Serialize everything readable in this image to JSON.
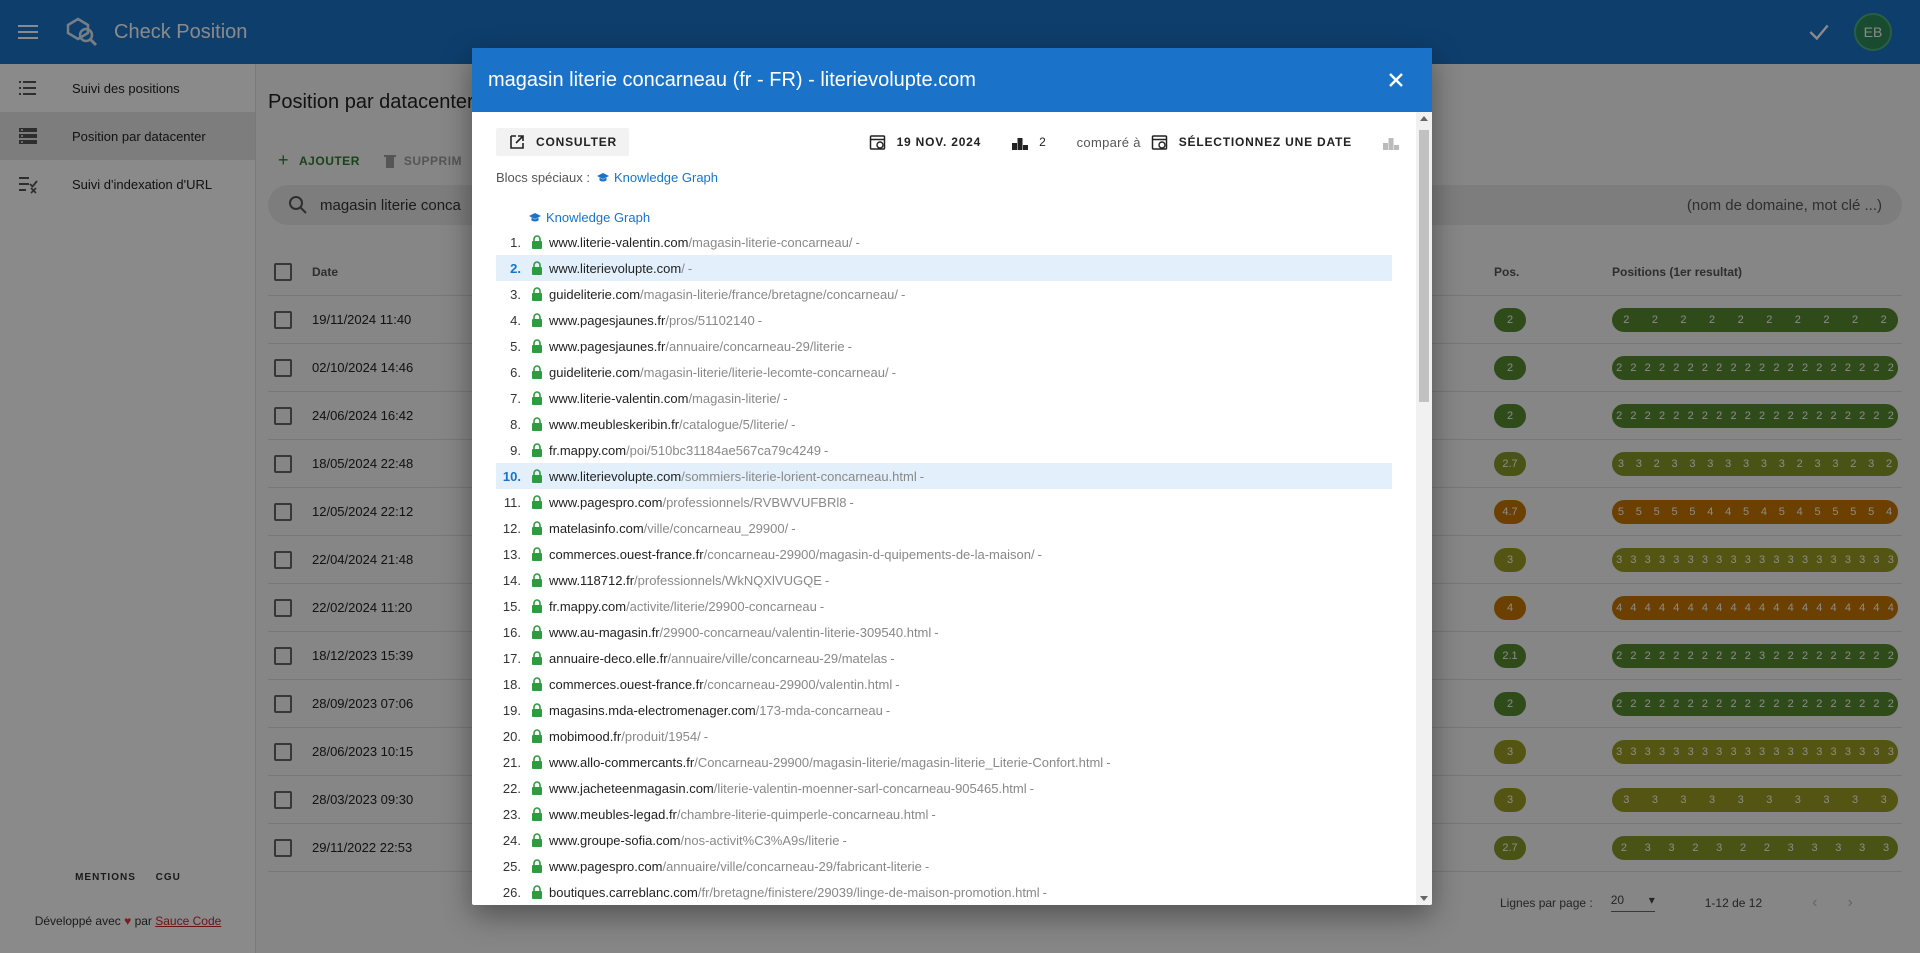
{
  "app": {
    "title": "Check Position",
    "avatar": "EB"
  },
  "sidebar": {
    "items": [
      {
        "label": "Suivi des positions",
        "icon": "list-icon",
        "active": false
      },
      {
        "label": "Position par datacenter",
        "icon": "server-icon",
        "active": true
      },
      {
        "label": "Suivi d'indexation d'URL",
        "icon": "checklist-icon",
        "active": false
      }
    ],
    "footer_links": [
      "MENTIONS",
      "CGU"
    ],
    "dev_prefix": "Développé avec",
    "dev_middle": "par",
    "dev_brand": "Sauce Code"
  },
  "main": {
    "title": "Position par datacenter",
    "add_label": "AJOUTER",
    "delete_label": "SUPPRIM",
    "search_value": "magasin literie conca",
    "search_hint": "(nom de domaine, mot clé ...)",
    "columns": {
      "date": "Date",
      "pos": "Pos.",
      "positions": "Positions (1er resultat)"
    },
    "rows": [
      {
        "date": "19/11/2024 11:40",
        "pos": "2",
        "color": "#558b2f",
        "cells": [
          "2",
          "2",
          "2",
          "2",
          "2",
          "2",
          "2",
          "2",
          "2",
          "2"
        ]
      },
      {
        "date": "02/10/2024 14:46",
        "pos": "2",
        "color": "#558b2f",
        "cells": [
          "2",
          "2",
          "2",
          "2",
          "2",
          "2",
          "2",
          "2",
          "2",
          "2",
          "2",
          "2",
          "2",
          "2",
          "2",
          "2",
          "2",
          "2",
          "2",
          "2"
        ]
      },
      {
        "date": "24/06/2024 16:42",
        "pos": "2",
        "color": "#558b2f",
        "cells": [
          "2",
          "2",
          "2",
          "2",
          "2",
          "2",
          "2",
          "2",
          "2",
          "2",
          "2",
          "2",
          "2",
          "2",
          "2",
          "2",
          "2",
          "2",
          "2",
          "2"
        ]
      },
      {
        "date": "18/05/2024 22:48",
        "pos": "2.7",
        "color": "#8a9a2a",
        "cells": [
          "3",
          "3",
          "2",
          "3",
          "3",
          "3",
          "3",
          "3",
          "3",
          "3",
          "2",
          "3",
          "3",
          "2",
          "3",
          "2"
        ]
      },
      {
        "date": "12/05/2024 22:12",
        "pos": "4.7",
        "color": "#c77700",
        "cells": [
          "5",
          "5",
          "5",
          "5",
          "5",
          "4",
          "4",
          "5",
          "4",
          "5",
          "4",
          "5",
          "5",
          "5",
          "5",
          "4"
        ]
      },
      {
        "date": "22/04/2024 21:48",
        "pos": "3",
        "color": "#9e9d24",
        "cells": [
          "3",
          "3",
          "3",
          "3",
          "3",
          "3",
          "3",
          "3",
          "3",
          "3",
          "3",
          "3",
          "3",
          "3",
          "3",
          "3",
          "3",
          "3",
          "3",
          "3"
        ]
      },
      {
        "date": "22/02/2024 11:20",
        "pos": "4",
        "color": "#c77700",
        "cells": [
          "4",
          "4",
          "4",
          "4",
          "4",
          "4",
          "4",
          "4",
          "4",
          "4",
          "4",
          "4",
          "4",
          "4",
          "4",
          "4",
          "4",
          "4",
          "4",
          "4"
        ]
      },
      {
        "date": "18/12/2023 15:39",
        "pos": "2.1",
        "color": "#558b2f",
        "cells": [
          "2",
          "2",
          "2",
          "2",
          "2",
          "2",
          "2",
          "2",
          "2",
          "2",
          "3",
          "2",
          "2",
          "2",
          "2",
          "2",
          "2",
          "2",
          "2",
          "2"
        ]
      },
      {
        "date": "28/09/2023 07:06",
        "pos": "2",
        "color": "#558b2f",
        "cells": [
          "2",
          "2",
          "2",
          "2",
          "2",
          "2",
          "2",
          "2",
          "2",
          "2",
          "2",
          "2",
          "2",
          "2",
          "2",
          "2",
          "2",
          "2",
          "2",
          "2"
        ]
      },
      {
        "date": "28/06/2023 10:15",
        "pos": "3",
        "color": "#9e9d24",
        "cells": [
          "3",
          "3",
          "3",
          "3",
          "3",
          "3",
          "3",
          "3",
          "3",
          "3",
          "3",
          "3",
          "3",
          "3",
          "3",
          "3",
          "3",
          "3",
          "3",
          "3"
        ]
      },
      {
        "date": "28/03/2023 09:30",
        "pos": "3",
        "color": "#9e9d24",
        "cells": [
          "3",
          "3",
          "3",
          "3",
          "3",
          "3",
          "3",
          "3",
          "3",
          "3"
        ]
      },
      {
        "date": "29/11/2022 22:53",
        "pos": "2.7",
        "color": "#8a9a2a",
        "cells": [
          "2",
          "3",
          "3",
          "2",
          "3",
          "2",
          "2",
          "3",
          "3",
          "3",
          "3",
          "3"
        ]
      }
    ],
    "pager": {
      "label": "Lignes par page :",
      "per_page": "20",
      "range": "1-12 de 12"
    }
  },
  "dialog": {
    "title": "magasin literie concarneau (fr - FR) - literievolupte.com",
    "consult_label": "CONSULTER",
    "date": "19 NOV. 2024",
    "count": "2",
    "compare_label": "comparé à",
    "select_date": "SÉLECTIONNEZ UNE DATE",
    "special_label": "Blocs spéciaux :",
    "knowledge_graph": "Knowledge Graph",
    "results": [
      {
        "n": "1.",
        "dom": "www.literie-valentin.com",
        "path": "/magasin-literie-concarneau/",
        "hl": false
      },
      {
        "n": "2.",
        "dom": "www.literievolupte.com",
        "path": "/",
        "hl": true
      },
      {
        "n": "3.",
        "dom": "guideliterie.com",
        "path": "/magasin-literie/france/bretagne/concarneau/",
        "hl": false
      },
      {
        "n": "4.",
        "dom": "www.pagesjaunes.fr",
        "path": "/pros/51102140",
        "hl": false
      },
      {
        "n": "5.",
        "dom": "www.pagesjaunes.fr",
        "path": "/annuaire/concarneau-29/literie",
        "hl": false
      },
      {
        "n": "6.",
        "dom": "guideliterie.com",
        "path": "/magasin-literie/literie-lecomte-concarneau/",
        "hl": false
      },
      {
        "n": "7.",
        "dom": "www.literie-valentin.com",
        "path": "/magasin-literie/",
        "hl": false
      },
      {
        "n": "8.",
        "dom": "www.meubleskeribin.fr",
        "path": "/catalogue/5/literie/",
        "hl": false
      },
      {
        "n": "9.",
        "dom": "fr.mappy.com",
        "path": "/poi/510bc31184ae567ca79c4249",
        "hl": false
      },
      {
        "n": "10.",
        "dom": "www.literievolupte.com",
        "path": "/sommiers-literie-lorient-concarneau.html",
        "hl": true
      },
      {
        "n": "11.",
        "dom": "www.pagespro.com",
        "path": "/professionnels/RVBWVUFBRl8",
        "hl": false
      },
      {
        "n": "12.",
        "dom": "matelasinfo.com",
        "path": "/ville/concarneau_29900/",
        "hl": false
      },
      {
        "n": "13.",
        "dom": "commerces.ouest-france.fr",
        "path": "/concarneau-29900/magasin-d-quipements-de-la-maison/",
        "hl": false
      },
      {
        "n": "14.",
        "dom": "www.118712.fr",
        "path": "/professionnels/WkNQXlVUGQE",
        "hl": false
      },
      {
        "n": "15.",
        "dom": "fr.mappy.com",
        "path": "/activite/literie/29900-concarneau",
        "hl": false
      },
      {
        "n": "16.",
        "dom": "www.au-magasin.fr",
        "path": "/29900-concarneau/valentin-literie-309540.html",
        "hl": false
      },
      {
        "n": "17.",
        "dom": "annuaire-deco.elle.fr",
        "path": "/annuaire/ville/concarneau-29/matelas",
        "hl": false
      },
      {
        "n": "18.",
        "dom": "commerces.ouest-france.fr",
        "path": "/concarneau-29900/valentin.html",
        "hl": false
      },
      {
        "n": "19.",
        "dom": "magasins.mda-electromenager.com",
        "path": "/173-mda-concarneau",
        "hl": false
      },
      {
        "n": "20.",
        "dom": "mobimood.fr",
        "path": "/produit/1954/",
        "hl": false
      },
      {
        "n": "21.",
        "dom": "www.allo-commercants.fr",
        "path": "/Concarneau-29900/magasin-literie/magasin-literie_Literie-Confort.html",
        "hl": false
      },
      {
        "n": "22.",
        "dom": "www.jacheteenmagasin.com",
        "path": "/literie-valentin-moenner-sarl-concarneau-905465.html",
        "hl": false
      },
      {
        "n": "23.",
        "dom": "www.meubles-legad.fr",
        "path": "/chambre-literie-quimperle-concarneau.html",
        "hl": false
      },
      {
        "n": "24.",
        "dom": "www.groupe-sofia.com",
        "path": "/nos-activit%C3%A9s/literie",
        "hl": false
      },
      {
        "n": "25.",
        "dom": "www.pagespro.com",
        "path": "/annuaire/ville/concarneau-29/fabricant-literie",
        "hl": false
      },
      {
        "n": "26.",
        "dom": "boutiques.carreblanc.com",
        "path": "/fr/bretagne/finistere/29039/linge-de-maison-promotion.html",
        "hl": false
      }
    ]
  }
}
